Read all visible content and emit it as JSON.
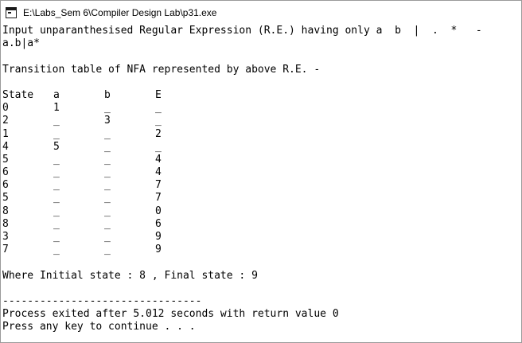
{
  "window": {
    "title": "E:\\Labs_Sem 6\\Compiler Design Lab\\p31.exe",
    "icon": "console-app-icon"
  },
  "console": {
    "prompt": "Input unparanthesised Regular Expression (R.E.) having only a  b  |  .  *   -",
    "input": "a.b|a*",
    "heading": "Transition table of NFA represented by above R.E. -",
    "table": {
      "headers": [
        "State",
        "a",
        "b",
        "E"
      ],
      "rows": [
        [
          "0",
          "1",
          "_",
          "_"
        ],
        [
          "2",
          "_",
          "3",
          "_"
        ],
        [
          "1",
          "_",
          "_",
          "2"
        ],
        [
          "4",
          "5",
          "_",
          "_"
        ],
        [
          "5",
          "_",
          "_",
          "4"
        ],
        [
          "6",
          "_",
          "_",
          "4"
        ],
        [
          "6",
          "_",
          "_",
          "7"
        ],
        [
          "5",
          "_",
          "_",
          "7"
        ],
        [
          "8",
          "_",
          "_",
          "0"
        ],
        [
          "8",
          "_",
          "_",
          "6"
        ],
        [
          "3",
          "_",
          "_",
          "9"
        ],
        [
          "7",
          "_",
          "_",
          "9"
        ]
      ]
    },
    "summary": "Where Initial state : 8 , Final state : 9",
    "separator": "--------------------------------",
    "exit_message": "Process exited after 5.012 seconds with return value 0",
    "continue_message": "Press any key to continue . . ."
  }
}
